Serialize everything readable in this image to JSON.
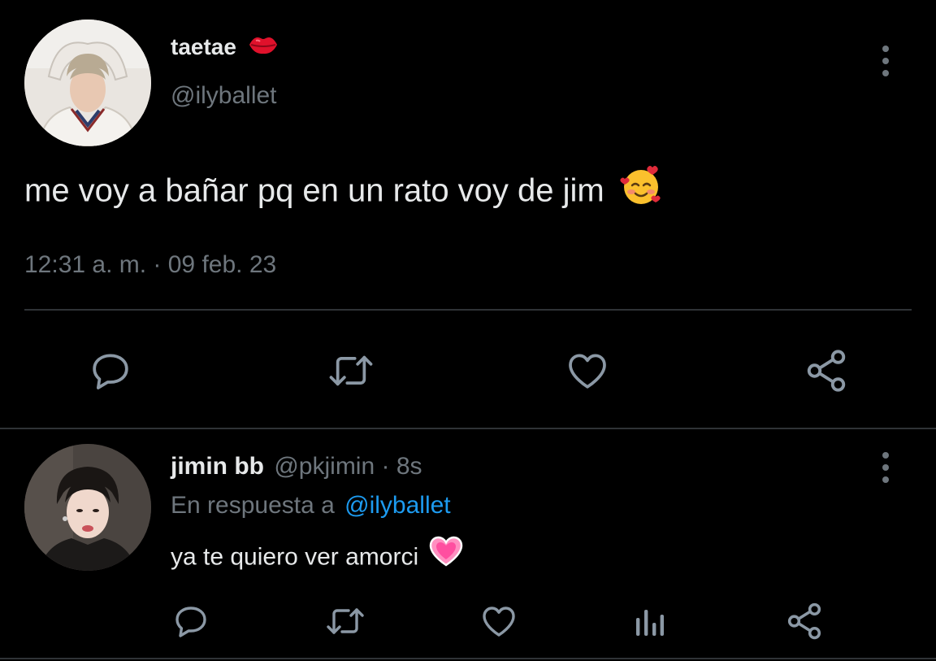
{
  "colors": {
    "background": "#000000",
    "text": "#e7e9ea",
    "muted": "#6e767d",
    "divider": "#2f3336",
    "link": "#1d9bf0",
    "action_icon": "#8b98a5"
  },
  "main_tweet": {
    "display_name": "taetae",
    "name_emoji": "kiss-lips",
    "handle": "@ilyballet",
    "text": "me voy a bañar pq en un rato voy de jim",
    "text_emoji": "smiling-face-with-hearts",
    "timestamp": "12:31 a. m. · 09 feb. 23",
    "actions": [
      "reply-icon",
      "retweet-icon",
      "like-icon",
      "share-icon"
    ]
  },
  "reply_tweet": {
    "display_name": "jimin bb",
    "handle": "@pkjimin",
    "time_ago": "· 8s",
    "reply_prefix": "En respuesta a",
    "reply_to": "@ilyballet",
    "text": "ya te quiero ver amorci",
    "text_emoji": "growing-pink-heart",
    "actions": [
      "reply-icon",
      "retweet-icon",
      "like-icon",
      "analytics-icon",
      "share-icon"
    ]
  }
}
